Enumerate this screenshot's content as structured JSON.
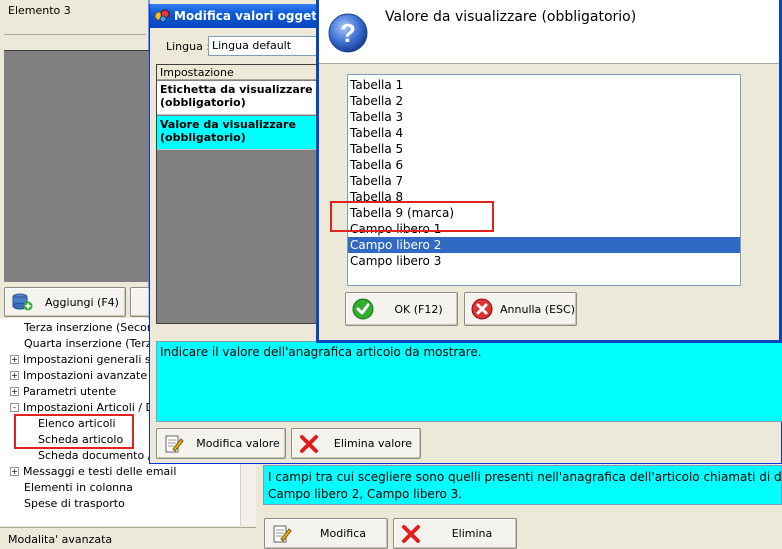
{
  "background": {
    "element_title": "Elemento 3",
    "add_button": "Aggiungi (F4)",
    "tree_items": [
      {
        "label": "Terza inserzione (Secondo",
        "expander": false,
        "indent": 1
      },
      {
        "label": "Quarta inserzione (Terzo b",
        "expander": false,
        "indent": 1
      },
      {
        "label": "Impostazioni generali sito",
        "expander": true,
        "sign": "+",
        "indent": 0
      },
      {
        "label": "Impostazioni avanzate sito",
        "expander": true,
        "sign": "+",
        "indent": 0
      },
      {
        "label": "Parametri utente",
        "expander": true,
        "sign": "+",
        "indent": 0
      },
      {
        "label": "Impostazioni Articoli / Doc",
        "expander": true,
        "sign": "-",
        "indent": 0
      },
      {
        "label": "Elenco articoli",
        "expander": false,
        "indent": 2
      },
      {
        "label": "Scheda articolo",
        "expander": false,
        "indent": 2
      },
      {
        "label": "Scheda documento / E",
        "expander": false,
        "indent": 2
      },
      {
        "label": "Messaggi e testi delle email",
        "expander": true,
        "sign": "+",
        "indent": 0
      },
      {
        "label": "Elementi in colonna",
        "expander": false,
        "indent": 1
      },
      {
        "label": "Spese di trasporto",
        "expander": false,
        "indent": 1
      }
    ],
    "status_text": "Modalita' avanzata",
    "info_text_line1": "I campi tra cui scegliere sono quelli presenti nell'anagrafica dell'articolo chiamati di default",
    "info_text_line2": "Campo libero 2, Campo libero 3.",
    "modify_button": "Modifica",
    "delete_button": "Elimina"
  },
  "middle_window": {
    "title": "Modifica valori oggetto",
    "language_label": "Lingua :",
    "language_value": "Lingua default",
    "grid_header": "Impostazione",
    "grid_rows": [
      "Etichetta da visualizzare (obbligatorio)",
      "Valore da visualizzare (obbligatorio)"
    ],
    "description": "Indicare il valore dell'anagrafica articolo da mostrare.",
    "modify_value_button": "Modifica valore",
    "delete_value_button": "Elimina valore"
  },
  "dialog": {
    "title": "Valore da visualizzare (obbligatorio)",
    "options": [
      "Tabella 1",
      "Tabella 2",
      "Tabella 3",
      "Tabella 4",
      "Tabella 5",
      "Tabella 6",
      "Tabella 7",
      "Tabella 8",
      "Tabella 9 (marca)",
      "Campo libero 1",
      "Campo libero 2",
      "Campo libero 3"
    ],
    "selected_option": "Campo libero 2",
    "ok_button": "OK (F12)",
    "cancel_button": "Annulla (ESC)"
  },
  "colors": {
    "cyan": "#00ffff",
    "selection": "#316ac5",
    "highlight_box": "#e0231f",
    "xp_title_blue": "#0a5bd5"
  }
}
